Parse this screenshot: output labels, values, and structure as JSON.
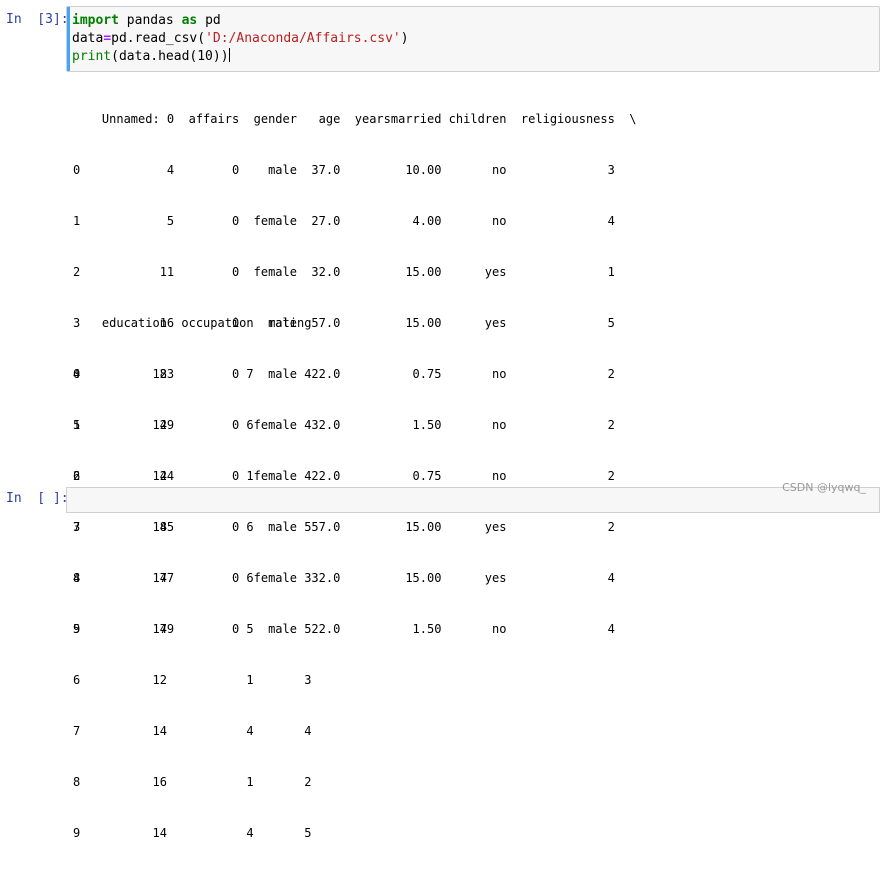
{
  "cell1": {
    "prompt": "In  [3]:",
    "code": {
      "line1": {
        "kw1": "import",
        "mod": " pandas ",
        "kw2": "as",
        "alias": " pd"
      },
      "line2": {
        "lhs": "data",
        "op": "=",
        "call": "pd.read_csv(",
        "arg": "'D:/Anaconda/Affairs.csv'",
        "close": ")"
      },
      "line3": {
        "fn": "print",
        "rest": "(data.head(10))"
      }
    }
  },
  "output": {
    "table1": {
      "header": "    Unnamed: 0  affairs  gender   age  yearsmarried children  religiousness  \\",
      "rows": [
        "0            4        0    male  37.0         10.00       no              3",
        "1            5        0  female  27.0          4.00       no              4",
        "2           11        0  female  32.0         15.00      yes              1",
        "3           16        0    male  57.0         15.00      yes              5",
        "4           23        0    male  22.0          0.75       no              2",
        "5           29        0  female  32.0          1.50       no              2",
        "6           44        0  female  22.0          0.75       no              2",
        "7           45        0    male  57.0         15.00      yes              2",
        "8           47        0  female  32.0         15.00      yes              4",
        "9           49        0    male  22.0          1.50       no              4"
      ]
    },
    "table2": {
      "header": "    education  occupation  rating",
      "rows": [
        "0          18           7       4",
        "1          14           6       4",
        "2          12           1       4",
        "3          18           6       5",
        "4          17           6       3",
        "5          17           5       5",
        "6          12           1       3",
        "7          14           4       4",
        "8          16           1       2",
        "9          14           4       5"
      ]
    }
  },
  "cell2": {
    "prompt": "In  [ ]:"
  },
  "watermark": "CSDN @lyqwq_"
}
